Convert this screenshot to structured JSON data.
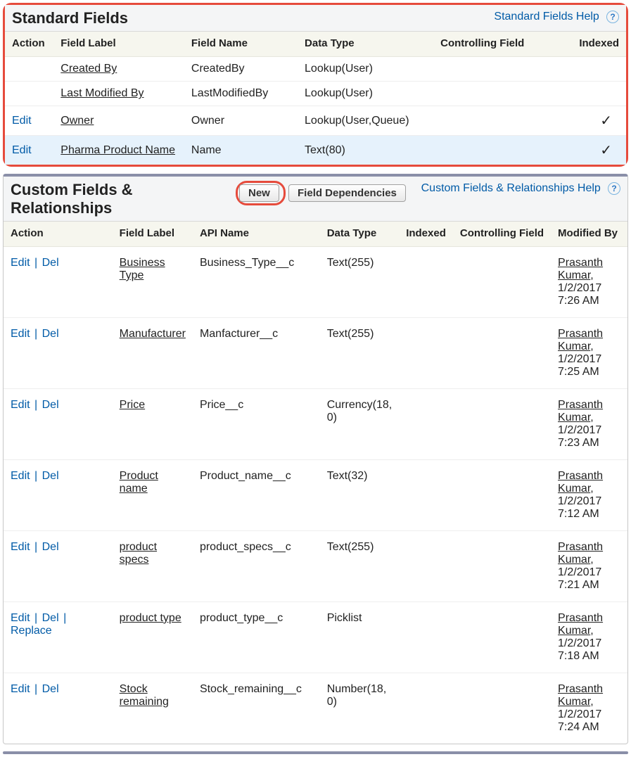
{
  "standard": {
    "title": "Standard Fields",
    "help": "Standard Fields Help",
    "headers": [
      "Action",
      "Field Label",
      "Field Name",
      "Data Type",
      "Controlling Field",
      "Indexed"
    ],
    "rows": [
      {
        "edit": "",
        "label": "Created By",
        "name": "CreatedBy",
        "type": "Lookup(User)",
        "ctrl": "",
        "indexed": false
      },
      {
        "edit": "",
        "label": "Last Modified By",
        "name": "LastModifiedBy",
        "type": "Lookup(User)",
        "ctrl": "",
        "indexed": false
      },
      {
        "edit": "Edit",
        "label": "Owner",
        "name": "Owner",
        "type": "Lookup(User,Queue)",
        "ctrl": "",
        "indexed": true
      },
      {
        "edit": "Edit",
        "label": "Pharma Product Name",
        "name": "Name",
        "type": "Text(80)",
        "ctrl": "",
        "indexed": true,
        "hl": true
      }
    ]
  },
  "custom": {
    "title": "Custom Fields & Relationships",
    "help": "Custom Fields & Relationships Help",
    "btn_new": "New",
    "btn_dep": "Field Dependencies",
    "headers": [
      "Action",
      "Field Label",
      "API Name",
      "Data Type",
      "Indexed",
      "Controlling Field",
      "Modified By"
    ],
    "actions": {
      "edit": "Edit",
      "del": "Del",
      "replace": "Replace"
    },
    "rows": [
      {
        "acts": [
          "edit",
          "del"
        ],
        "label": "Business Type",
        "api": "Business_Type__c",
        "type": "Text(255)",
        "idx": "",
        "ctrl": "",
        "mod_by": "Prasanth Kumar",
        "mod_at": "1/2/2017 7:26 AM"
      },
      {
        "acts": [
          "edit",
          "del"
        ],
        "label": "Manufacturer",
        "api": "Manfacturer__c",
        "type": "Text(255)",
        "idx": "",
        "ctrl": "",
        "mod_by": "Prasanth Kumar",
        "mod_at": "1/2/2017 7:25 AM"
      },
      {
        "acts": [
          "edit",
          "del"
        ],
        "label": "Price",
        "api": "Price__c",
        "type": "Currency(18, 0)",
        "idx": "",
        "ctrl": "",
        "mod_by": "Prasanth Kumar",
        "mod_at": "1/2/2017 7:23 AM"
      },
      {
        "acts": [
          "edit",
          "del"
        ],
        "label": "Product name",
        "api": "Product_name__c",
        "type": "Text(32)",
        "idx": "",
        "ctrl": "",
        "mod_by": "Prasanth Kumar",
        "mod_at": "1/2/2017 7:12 AM"
      },
      {
        "acts": [
          "edit",
          "del"
        ],
        "label": "product specs",
        "api": "product_specs__c",
        "type": "Text(255)",
        "idx": "",
        "ctrl": "",
        "mod_by": "Prasanth Kumar",
        "mod_at": "1/2/2017 7:21 AM"
      },
      {
        "acts": [
          "edit",
          "del",
          "replace"
        ],
        "label": "product type",
        "api": "product_type__c",
        "type": "Picklist",
        "idx": "",
        "ctrl": "",
        "mod_by": "Prasanth Kumar",
        "mod_at": "1/2/2017 7:18 AM"
      },
      {
        "acts": [
          "edit",
          "del"
        ],
        "label": "Stock remaining",
        "api": "Stock_remaining__c",
        "type": "Number(18, 0)",
        "idx": "",
        "ctrl": "",
        "mod_by": "Prasanth Kumar",
        "mod_at": "1/2/2017 7:24 AM"
      }
    ]
  }
}
